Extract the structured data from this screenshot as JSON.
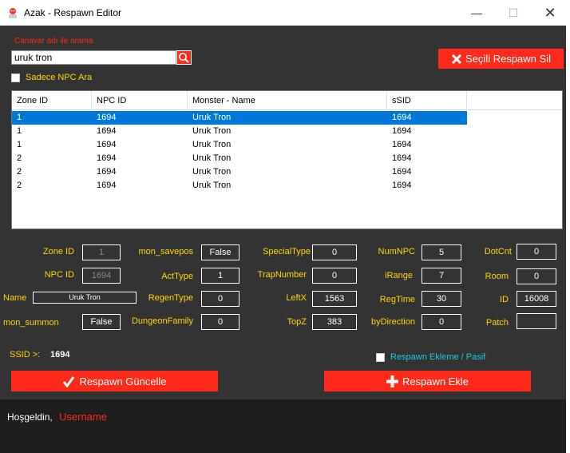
{
  "window": {
    "title": "Azak - Respawn Editor",
    "minimize": "—",
    "maximize": "☐",
    "close": "✕"
  },
  "search": {
    "label": "Canavar adı ile arama",
    "value": "uruk tron",
    "button_icon": "search-icon"
  },
  "delete_button": {
    "label": "Seçili Respawn Sil",
    "icon": "close-x-icon"
  },
  "npc_only": {
    "label": "Sadece NPC Ara",
    "checked": false
  },
  "grid": {
    "columns": [
      "Zone ID",
      "NPC ID",
      "Monster - Name",
      "sSID"
    ],
    "rows": [
      [
        "1",
        "1694",
        "Uruk Tron",
        "1694"
      ],
      [
        "1",
        "1694",
        "Uruk Tron",
        "1694"
      ],
      [
        "1",
        "1694",
        "Uruk Tron",
        "1694"
      ],
      [
        "2",
        "1694",
        "Uruk Tron",
        "1694"
      ],
      [
        "2",
        "1694",
        "Uruk Tron",
        "1694"
      ],
      [
        "2",
        "1694",
        "Uruk Tron",
        "1694"
      ]
    ],
    "selected_row": 0
  },
  "fields": {
    "zone_id": {
      "label": "Zone ID",
      "value": "1"
    },
    "npc_id": {
      "label": "NPC ID",
      "value": "1694"
    },
    "name": {
      "label": "Name",
      "value": "Uruk Tron"
    },
    "mon_summon": {
      "label": "mon_summon",
      "value": "False"
    },
    "mon_savepos": {
      "label": "mon_savepos",
      "value": "False"
    },
    "act_type": {
      "label": "ActType",
      "value": "1"
    },
    "regen_type": {
      "label": "RegenType",
      "value": "0"
    },
    "dungeon_family": {
      "label": "DungeonFamily",
      "value": "0"
    },
    "special_type": {
      "label": "SpecialType",
      "value": "0"
    },
    "trap_number": {
      "label": "TrapNumber",
      "value": "0"
    },
    "left_x": {
      "label": "LeftX",
      "value": "1563"
    },
    "top_z": {
      "label": "TopZ",
      "value": "383"
    },
    "num_npc": {
      "label": "NumNPC",
      "value": "5"
    },
    "i_range": {
      "label": "iRange",
      "value": "7"
    },
    "reg_time": {
      "label": "RegTime",
      "value": "30"
    },
    "by_direction": {
      "label": "byDirection",
      "value": "0"
    },
    "dot_cnt": {
      "label": "DotCnt",
      "value": "0"
    },
    "room": {
      "label": "Room",
      "value": "0"
    },
    "id": {
      "label": "ID",
      "value": "16008"
    },
    "patch": {
      "label": "Patch",
      "value": ""
    }
  },
  "ssid": {
    "label": "SSID >:",
    "value": "1694"
  },
  "pasif": {
    "label": "Respawn Ekleme / Pasif",
    "checked": false
  },
  "update_button": {
    "label": "Respawn Güncelle",
    "icon": "check-icon"
  },
  "add_button": {
    "label": "Respawn Ekle",
    "icon": "plus-icon"
  },
  "status": {
    "welcome": "Hoşgeldin,",
    "username": "Username"
  },
  "colors": {
    "accent": "#ff2a1a",
    "label": "#ffd700",
    "selection": "#0078d7",
    "link": "#1ec8e0"
  }
}
